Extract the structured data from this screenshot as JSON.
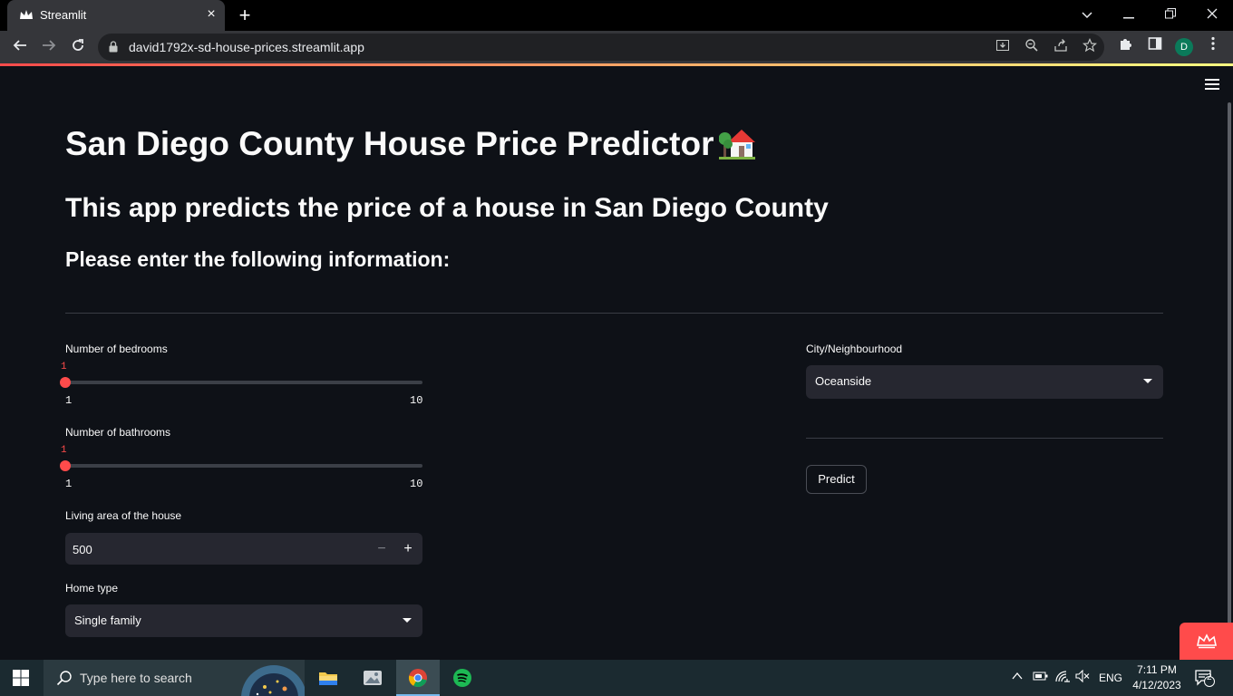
{
  "browser": {
    "tab_title": "Streamlit",
    "url": "david1792x-sd-house-prices.streamlit.app",
    "profile_initial": "D"
  },
  "app": {
    "title": "San Diego County House Price Predictor",
    "title_emoji": "house-with-garden-icon",
    "subtitle": "This app predicts the price of a house in San Diego County",
    "prompt": "Please enter the following information:",
    "bedrooms": {
      "label": "Number of bedrooms",
      "value": "1",
      "min": "1",
      "max": "10"
    },
    "bathrooms": {
      "label": "Number of bathrooms",
      "value": "1",
      "min": "1",
      "max": "10"
    },
    "living_area": {
      "label": "Living area of the house",
      "value": "500",
      "minus": "−",
      "plus": "+"
    },
    "home_type": {
      "label": "Home type",
      "value": "Single family"
    },
    "city": {
      "label": "City/Neighbourhood",
      "value": "Oceanside"
    },
    "predict_label": "Predict",
    "accent_color": "#ff4b4b"
  },
  "taskbar": {
    "search_placeholder": "Type here to search",
    "language": "ENG",
    "time": "7:11 PM",
    "date": "4/12/2023",
    "notification_count": "2"
  }
}
